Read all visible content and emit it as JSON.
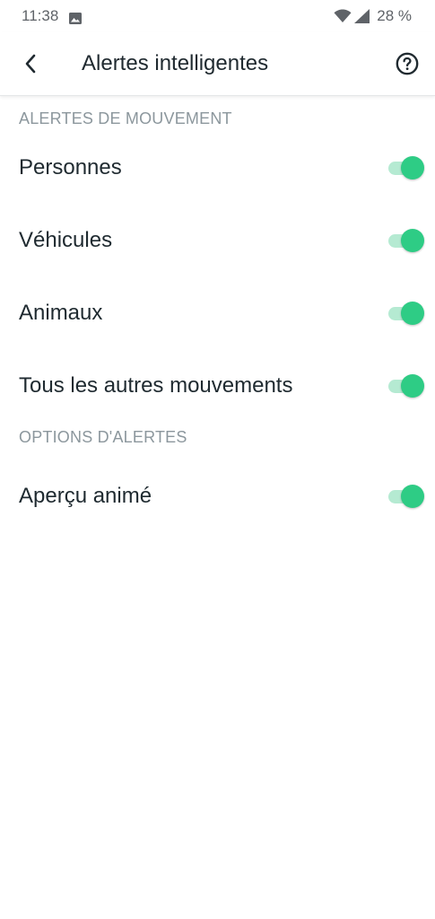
{
  "status_bar": {
    "time": "11:38",
    "battery": "28 %",
    "icons": [
      "image-icon",
      "wifi-icon",
      "signal-icon"
    ]
  },
  "app_bar": {
    "title": "Alertes intelligentes",
    "back_icon": "chevron-left-icon",
    "help_icon": "help-circle-icon"
  },
  "sections": [
    {
      "header": "ALERTES DE MOUVEMENT",
      "items": [
        {
          "label": "Personnes",
          "enabled": true
        },
        {
          "label": "Véhicules",
          "enabled": true
        },
        {
          "label": "Animaux",
          "enabled": true
        },
        {
          "label": "Tous les autres mouvements",
          "enabled": true
        }
      ]
    },
    {
      "header": "OPTIONS D'ALERTES",
      "items": [
        {
          "label": "Aperçu animé",
          "enabled": true
        }
      ]
    }
  ],
  "colors": {
    "toggle_thumb": "#2ecc85",
    "toggle_track": "#b5ead2",
    "section_header": "#8c979d",
    "text_primary": "#1f2a30"
  }
}
